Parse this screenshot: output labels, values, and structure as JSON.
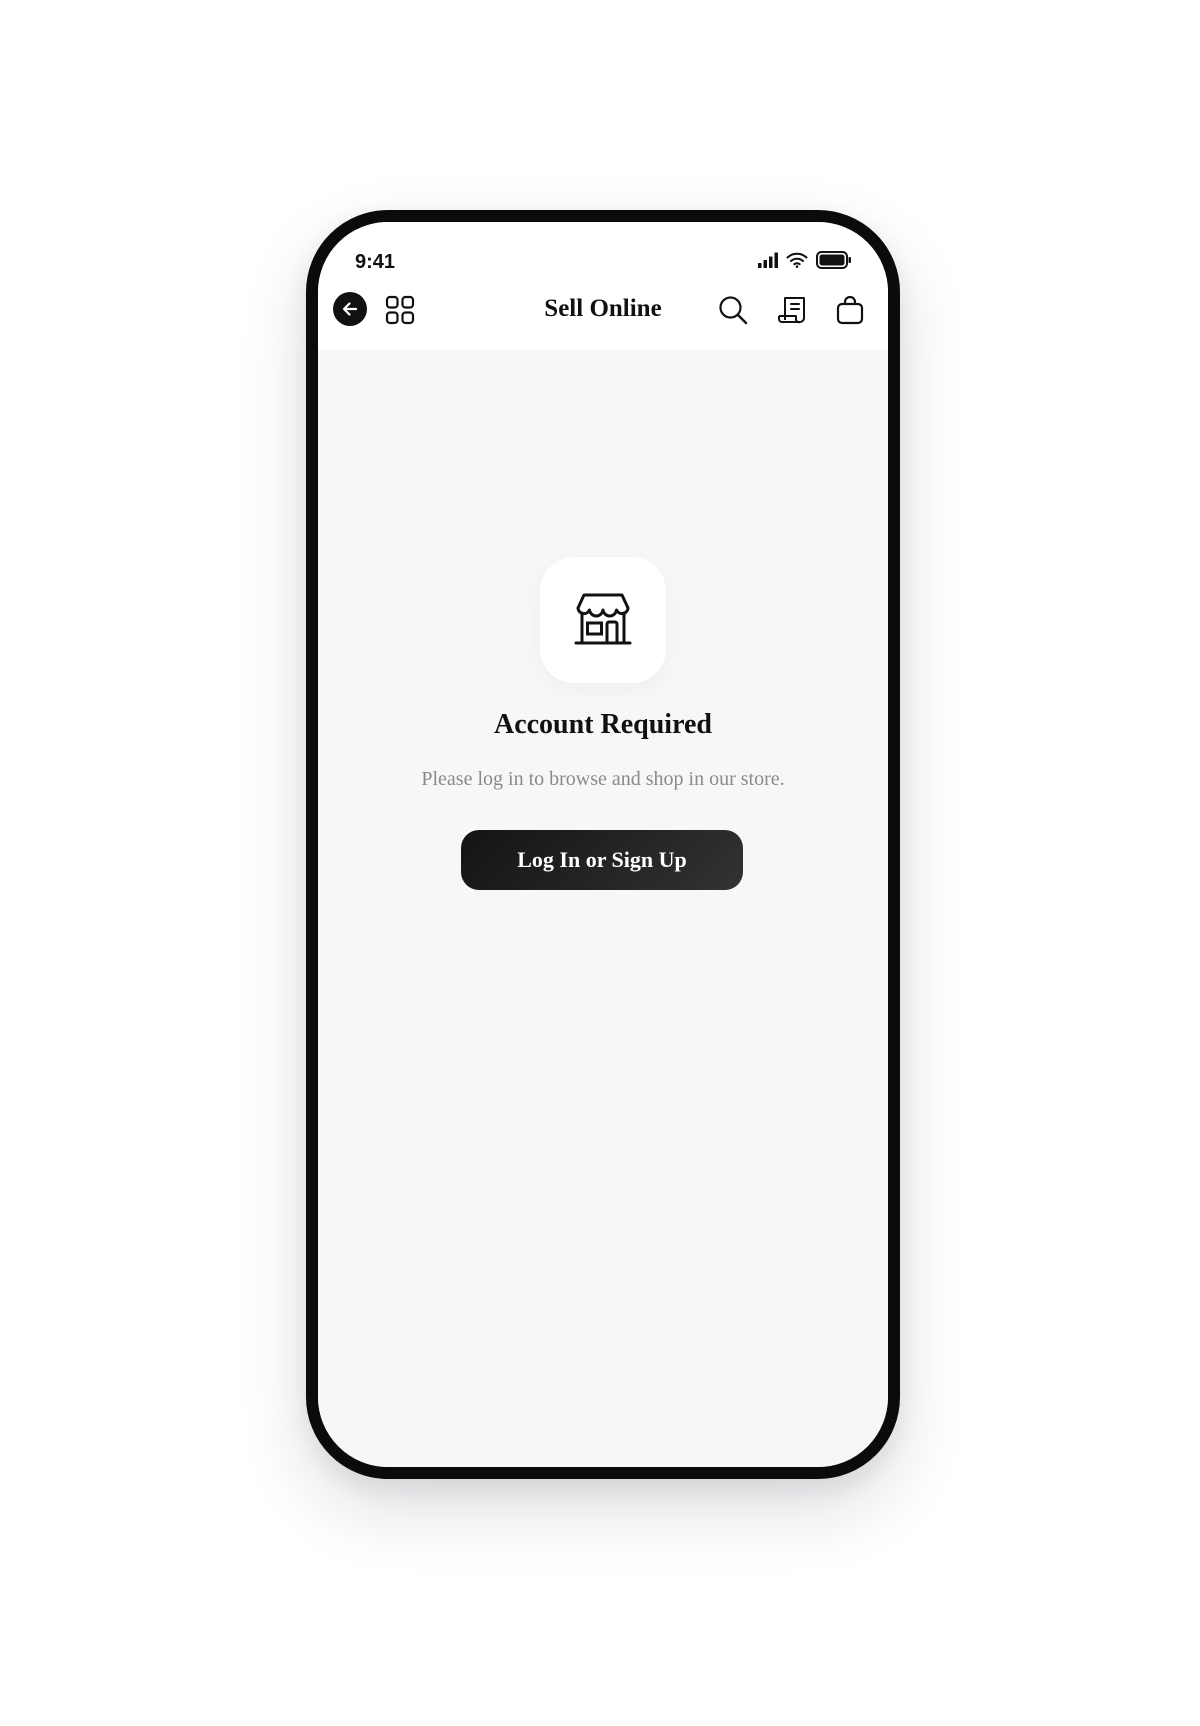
{
  "status_bar": {
    "time": "9:41",
    "icons": [
      "cellular-signal-icon",
      "wifi-icon",
      "battery-icon"
    ]
  },
  "nav": {
    "title": "Sell Online",
    "left_icons": [
      "back-arrow-icon",
      "grid-icon"
    ],
    "right_icons": [
      "search-icon",
      "receipt-icon",
      "shopping-bag-icon"
    ]
  },
  "empty_state": {
    "icon": "storefront-icon",
    "title": "Account Required",
    "subtitle": "Please log in to browse and shop in our store.",
    "button_label": "Log In or Sign Up"
  },
  "colors": {
    "background": "#f7f7f7",
    "surface": "#ffffff",
    "text_primary": "#111111",
    "text_secondary": "#8a8a8a",
    "button_background": "#1c1c1c",
    "button_text": "#ffffff"
  }
}
